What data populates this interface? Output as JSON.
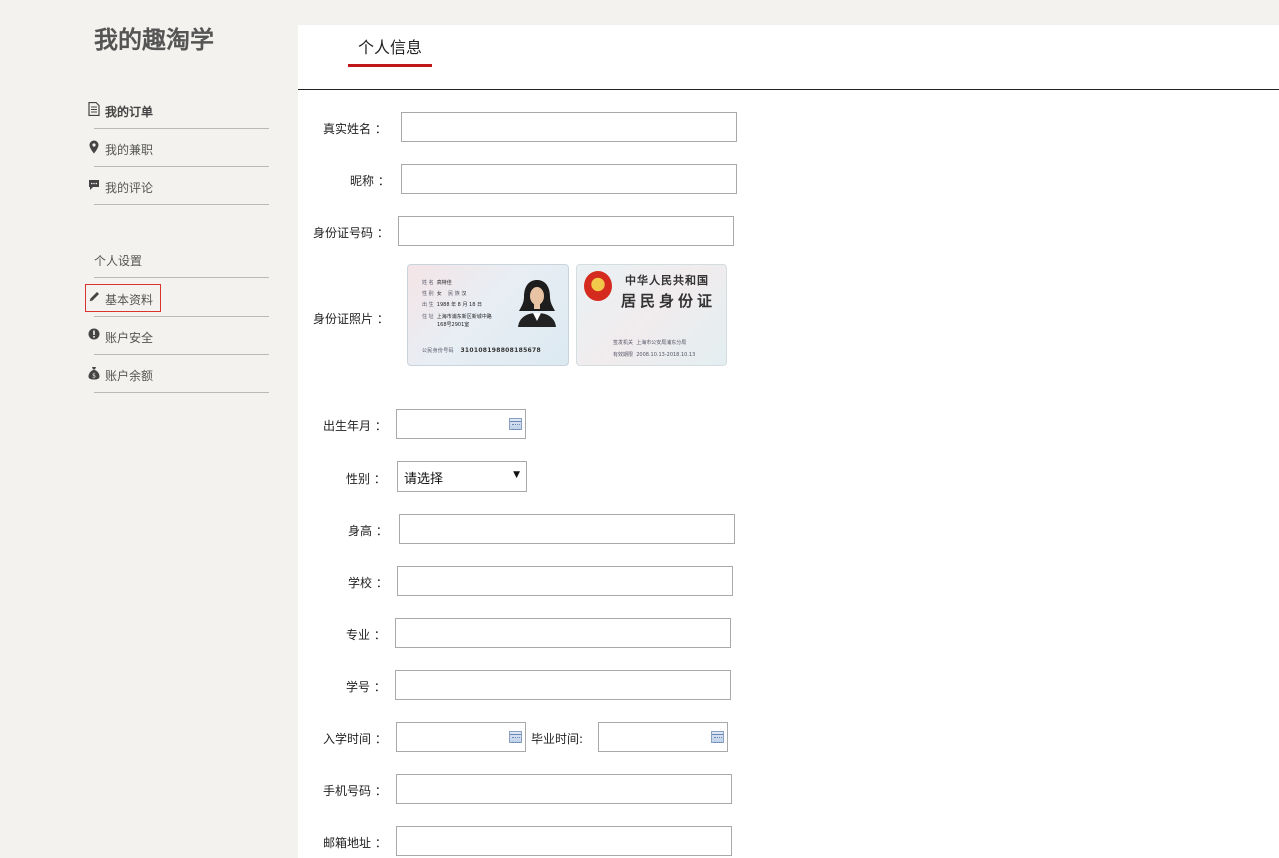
{
  "sidebar": {
    "logo": "我的趣淘学",
    "items": [
      {
        "label": "我的订单",
        "icon": "document-icon"
      },
      {
        "label": "我的兼职",
        "icon": "map-pin-icon"
      },
      {
        "label": "我的评论",
        "icon": "comment-icon"
      }
    ],
    "section_title": "个人设置",
    "settings": [
      {
        "label": "基本资料",
        "icon": "pencil-icon"
      },
      {
        "label": "账户安全",
        "icon": "alert-icon"
      },
      {
        "label": "账户余额",
        "icon": "money-bag-icon"
      }
    ]
  },
  "main": {
    "tab": "个人信息",
    "form": {
      "real_name_label": "真实姓名 ：",
      "nickname_label": "昵称 ：",
      "id_number_label": "身份证号码 ：",
      "id_photo_label": "身份证照片 ：",
      "birth_label": "出生年月 ：",
      "gender_label": "性别 ：",
      "gender_value": "请选择",
      "height_label": "身高 ：",
      "school_label": "学校 ：",
      "major_label": "专业 ：",
      "student_no_label": "学号 ：",
      "enroll_label": "入学时间 ：",
      "graduate_label": "毕业时间:",
      "phone_label": "手机号码 ：",
      "email_label": "邮箱地址 ："
    },
    "id_front": {
      "name_key": "姓 名",
      "name": "高特佳",
      "gender_key": "性 别",
      "gender": "女",
      "ethnicity_key": "民 族",
      "ethnicity": "汉",
      "birth_key": "出 生",
      "birth": "1988 年 8 月 18 日",
      "address_key": "住 址",
      "address_line1": "上海市浦东新区新城中路",
      "address_line2": "168号2901室",
      "number_key": "公民身份号码",
      "number": "310108198808185678"
    },
    "id_back": {
      "title1": "中华人民共和国",
      "title2": "居民身份证",
      "authority_key": "签发机关",
      "authority": "上海市公安局浦东分局",
      "validity_key": "有效期限",
      "validity": "2008.10.13-2018.10.13"
    }
  }
}
